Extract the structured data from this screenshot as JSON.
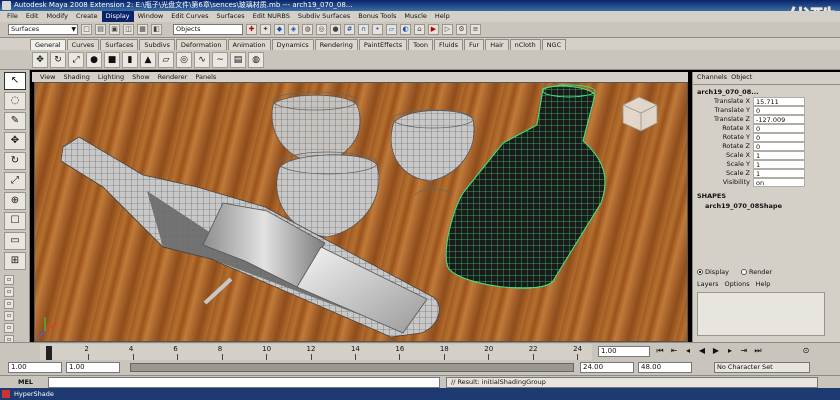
{
  "title": "Autodesk Maya 2008 Extension 2: E:\\瓶子\\光盘文件\\第6章\\sences\\玻璃材质.mb  ---  arch19_070_08...",
  "watermark": "优酷",
  "menu": [
    "File",
    "Edit",
    "Modify",
    "Create",
    "Display",
    "Window",
    "Edit Curves",
    "Surfaces",
    "Edit NURBS",
    "Subdiv Surfaces",
    "Bonus Tools",
    "Muscle",
    "Help"
  ],
  "menu_active_index": 4,
  "status": {
    "mode": "Surfaces",
    "objects_field": "Objects"
  },
  "shelf_tabs": [
    "General",
    "Curves",
    "Surfaces",
    "Subdivs",
    "Deformation",
    "Animation",
    "Dynamics",
    "Rendering",
    "PaintEffects",
    "Toon",
    "Fluids",
    "Fur",
    "Hair",
    "nCloth",
    "NGC"
  ],
  "shelf_active_index": 0,
  "viewport_menu": [
    "View",
    "Shading",
    "Lighting",
    "Show",
    "Renderer",
    "Panels"
  ],
  "channel_box": {
    "tabs": [
      "Channels",
      "Object"
    ],
    "object_name": "arch19_070_08...",
    "channels": [
      {
        "label": "Translate X",
        "value": "15.711"
      },
      {
        "label": "Translate Y",
        "value": "0"
      },
      {
        "label": "Translate Z",
        "value": "-127.009"
      },
      {
        "label": "Rotate X",
        "value": "0"
      },
      {
        "label": "Rotate Y",
        "value": "0"
      },
      {
        "label": "Rotate Z",
        "value": "0"
      },
      {
        "label": "Scale X",
        "value": "1"
      },
      {
        "label": "Scale Y",
        "value": "1"
      },
      {
        "label": "Scale Z",
        "value": "1"
      },
      {
        "label": "Visibility",
        "value": "on"
      }
    ],
    "shapes_header": "SHAPES",
    "shape_name": "arch19_070_08Shape",
    "layer_display": "Display",
    "layer_render": "Render",
    "layer_menu": [
      "Layers",
      "Options",
      "Help"
    ]
  },
  "timeline": {
    "ticks": [
      "2",
      "4",
      "6",
      "8",
      "10",
      "12",
      "14",
      "16",
      "18",
      "20",
      "22",
      "24"
    ],
    "current_frame": "1.00",
    "start": "1.00",
    "playback_start": "1.00",
    "playback_end": "24.00",
    "end": "48.00",
    "character_set": "No Character Set"
  },
  "command_line": {
    "label": "MEL",
    "result": "// Result: initialShadingGroup"
  },
  "taskbar": {
    "label": "HyperShade"
  }
}
